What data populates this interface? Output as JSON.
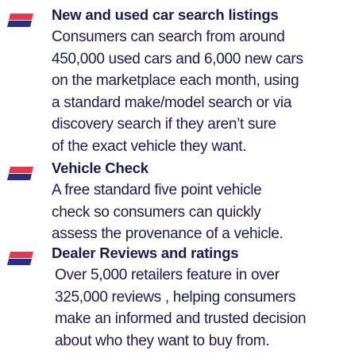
{
  "colors": {
    "text": "#1b1b4d",
    "flag_blue": "#2b2e83",
    "flag_red": "#e5384a"
  },
  "features": [
    {
      "icon": "flag-icon",
      "title": "New and used car search listings",
      "body": "Consumers can search from around\n450,000 used cars and 6,000 new cars\non the marketplace each month, using\na standard make/model search or via\ndiscovery search if they aren’t sure\nof the exact vehicle they want."
    },
    {
      "icon": "flag-icon",
      "title": "Vehicle Check",
      "body": "A free standard five point vehicle\ncheck so consumers can quickly\nassess the provenance of a vehicle."
    },
    {
      "icon": "flag-icon",
      "title": "Dealer Reviews and ratings",
      "body": "Over 5,000 retailers feature in over\n325,000 reviews , helping consumers\nmake an informed and trusted decision\nabout who they want to buy from."
    }
  ]
}
